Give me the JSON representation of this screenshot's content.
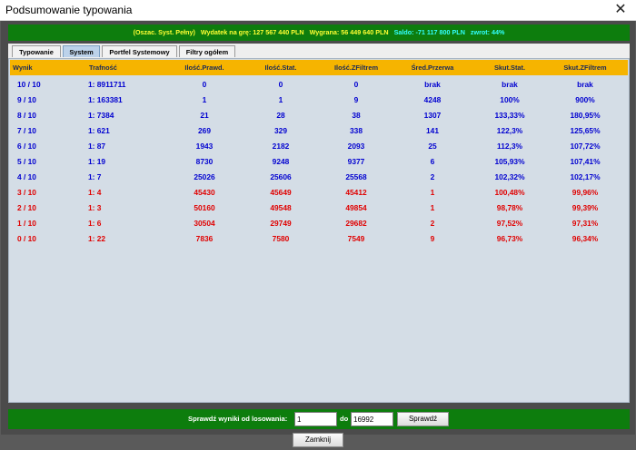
{
  "window": {
    "title": "Podsumowanie typowania",
    "close_glyph": "✕"
  },
  "summary": {
    "system": "(Oszac. Syst. Pełny)",
    "expense": "Wydatek na grę: 127 567 440 PLN",
    "win": "Wygrana: 56 449 640 PLN",
    "balance": "Saldo: -71 117 800 PLN",
    "ret": "zwrot: 44%"
  },
  "tabs": [
    "Typowanie",
    "System",
    "Portfel Systemowy",
    "Filtry ogółem"
  ],
  "active_tab": "System",
  "table": {
    "headers": [
      "Wynik",
      "Trafność",
      "Ilość.Prawd.",
      "Ilość.Stat.",
      "Ilość.ZFiltrem",
      "Śred.Przerwa",
      "Skut.Stat.",
      "Skut.ZFiltrem"
    ],
    "rows": [
      [
        "10 / 10",
        "1: 8911711",
        "0",
        "0",
        "0",
        "brak",
        "brak",
        "brak"
      ],
      [
        "9 / 10",
        "1: 163381",
        "1",
        "1",
        "9",
        "4248",
        "100%",
        "900%"
      ],
      [
        "8 / 10",
        "1: 7384",
        "21",
        "28",
        "38",
        "1307",
        "133,33%",
        "180,95%"
      ],
      [
        "7 / 10",
        "1: 621",
        "269",
        "329",
        "338",
        "141",
        "122,3%",
        "125,65%"
      ],
      [
        "6 / 10",
        "1: 87",
        "1943",
        "2182",
        "2093",
        "25",
        "112,3%",
        "107,72%"
      ],
      [
        "5 / 10",
        "1: 19",
        "8730",
        "9248",
        "9377",
        "6",
        "105,93%",
        "107,41%"
      ],
      [
        "4 / 10",
        "1: 7",
        "25026",
        "25606",
        "25568",
        "2",
        "102,32%",
        "102,17%"
      ],
      [
        "3 / 10",
        "1: 4",
        "45430",
        "45649",
        "45412",
        "1",
        "100,48%",
        "99,96%"
      ],
      [
        "2 / 10",
        "1: 3",
        "50160",
        "49548",
        "49854",
        "1",
        "98,78%",
        "99,39%"
      ],
      [
        "1 / 10",
        "1: 6",
        "30504",
        "29749",
        "29682",
        "2",
        "97,52%",
        "97,31%"
      ],
      [
        "0 / 10",
        "1: 22",
        "7836",
        "7580",
        "7549",
        "9",
        "96,73%",
        "96,34%"
      ]
    ],
    "row_colors": [
      "blue",
      "blue",
      "blue",
      "blue",
      "blue",
      "blue",
      "blue",
      "red",
      "red",
      "red",
      "red"
    ]
  },
  "check": {
    "label": "Sprawdź wyniki od losowania:",
    "from_value": "1",
    "to_label": "do",
    "to_value": "16992",
    "button": "Sprawdź"
  },
  "close_button": "Zamknij",
  "colors": {
    "header_bg": "#f6b400",
    "summary_bg": "#0d7d0d",
    "table_bg": "#d4dde6",
    "blue_text": "#0000d0",
    "red_text": "#e00000"
  }
}
